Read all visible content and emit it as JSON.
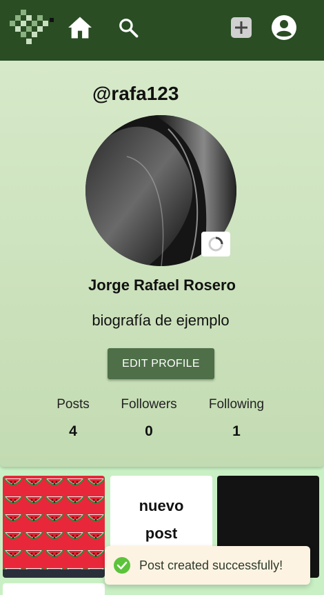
{
  "topbar": {
    "icons": [
      "logo-icon",
      "home-icon",
      "search-icon",
      "add-post-icon",
      "account-icon"
    ]
  },
  "profile": {
    "username": "@rafa123",
    "full_name": "Jorge Rafael Rosero",
    "bio": "biografía de ejemplo",
    "edit_label": "EDIT PROFILE",
    "stats": [
      {
        "label": "Posts",
        "value": "4"
      },
      {
        "label": "Followers",
        "value": "0"
      },
      {
        "label": "Following",
        "value": "1"
      }
    ]
  },
  "posts": [
    {
      "kind": "image",
      "description_icon": "watermelon-pattern"
    },
    {
      "kind": "text",
      "text_line1": "nuevo",
      "text_line2": "post"
    },
    {
      "kind": "image",
      "description_icon": "dark-image"
    },
    {
      "kind": "text"
    }
  ],
  "toast": {
    "message": "Post created successfully!",
    "icon": "check-circle-icon"
  },
  "colors": {
    "topbar": "#2a4d24",
    "accent_button": "#4e6f48",
    "toast_success": "#5cc33a"
  }
}
